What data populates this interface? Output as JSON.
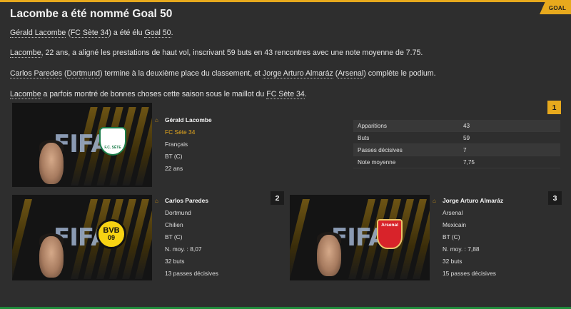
{
  "header": {
    "tag": "GOAL",
    "title": "Lacombe a été nommé Goal 50"
  },
  "article": {
    "p1": {
      "winner": "Gérald Lacombe",
      "open": " (",
      "club": "FC Sète 34",
      "rest": ") a été élu ",
      "award": "Goal 50",
      "end": "."
    },
    "p2": {
      "player": "Lacombe",
      "rest": ", 22 ans, a aligné les prestations de haut vol, inscrivant 59 buts en 43 rencontres avec une note moyenne de 7.75."
    },
    "p3": {
      "second": "Carlos Paredes",
      "open": " (",
      "club2": "Dortmund",
      "mid": ") termine à la deuxième place du classement, et ",
      "third": "Jorge Arturo Almaráz",
      "open2": " (",
      "club3": "Arsenal",
      "end": ") complète le podium."
    },
    "p4": {
      "player": "Lacombe",
      "rest": " a parfois montré de bonnes choses cette saison sous le maillot du ",
      "club": "FC Sète 34",
      "end": "."
    }
  },
  "first": {
    "rank": "1",
    "name": "Gérald Lacombe",
    "club": "FC Sète 34",
    "nationality": "Français",
    "position": "BT (C)",
    "age": "22 ans",
    "badge_text": "F.C. SÈTE",
    "stats": [
      {
        "label": "Apparitions",
        "value": "43"
      },
      {
        "label": "Buts",
        "value": "59"
      },
      {
        "label": "Passes décisives",
        "value": "7"
      },
      {
        "label": "Note moyenne",
        "value": "7,75"
      }
    ]
  },
  "second": {
    "rank": "2",
    "name": "Carlos Paredes",
    "club": "Dortmund",
    "nationality": "Chilien",
    "position": "BT (C)",
    "rating": "N. moy. : 8,07",
    "goals": "32 buts",
    "assists": "13 passes décisives",
    "badge_text": "BVB",
    "badge_year": "09"
  },
  "third": {
    "rank": "3",
    "name": "Jorge Arturo Almaráz",
    "club": "Arsenal",
    "nationality": "Mexicain",
    "position": "BT (C)",
    "rating": "N. moy. : 7,88",
    "goals": "32 buts",
    "assists": "15 passes décisives",
    "badge_text": "Arsenal"
  },
  "images": {
    "watermark": "FIFA"
  },
  "colors": {
    "accent": "#e7a91d",
    "bottom_bar": "#1f8a3a",
    "panel": "#2e2e2e"
  }
}
